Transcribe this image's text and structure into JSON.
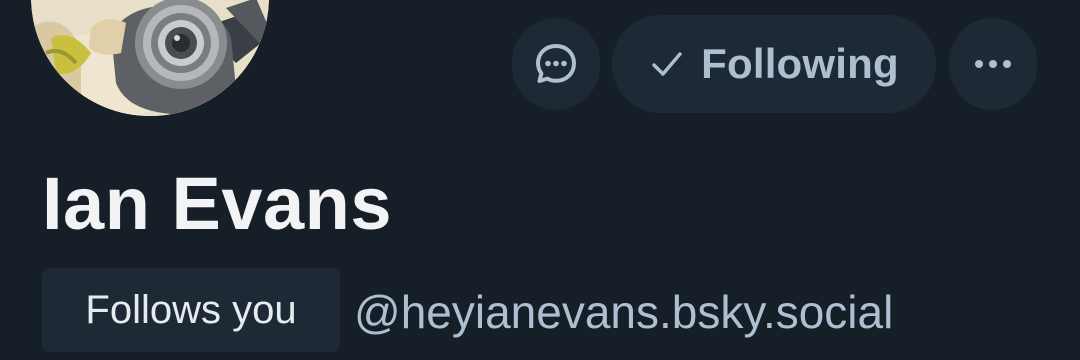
{
  "profile": {
    "display_name": "Ian Evans",
    "follows_you_badge": "Follows you",
    "handle": "@heyianevans.bsky.social"
  },
  "actions": {
    "message_icon": "chat-bubble-icon",
    "following_label": "Following",
    "following_icon": "check-icon",
    "more_icon": "ellipsis-icon"
  },
  "colors": {
    "background": "#161e27",
    "button_background": "#1e2936",
    "button_text": "#aebfd2",
    "name_text": "#f1f3f5"
  }
}
